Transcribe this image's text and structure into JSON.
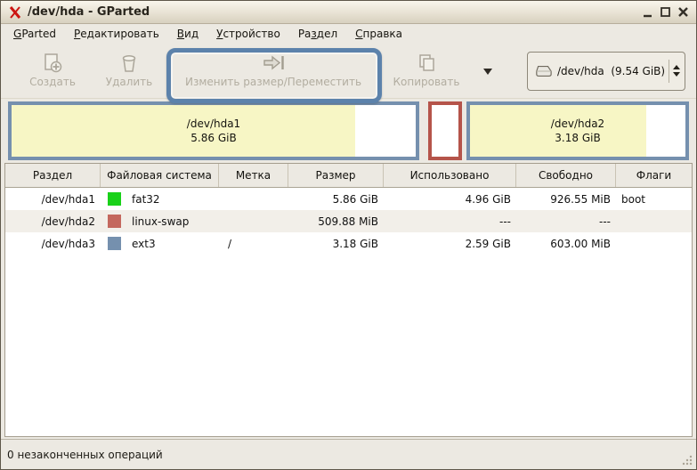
{
  "window": {
    "title": "/dev/hda - GParted"
  },
  "menubar": {
    "items": [
      {
        "pre": "",
        "accel": "G",
        "post": "Parted"
      },
      {
        "pre": "",
        "accel": "Р",
        "post": "едактировать"
      },
      {
        "pre": "",
        "accel": "В",
        "post": "ид"
      },
      {
        "pre": "",
        "accel": "У",
        "post": "стройство"
      },
      {
        "pre": "Ра",
        "accel": "з",
        "post": "дел"
      },
      {
        "pre": "",
        "accel": "С",
        "post": "правка"
      }
    ]
  },
  "toolbar": {
    "new_label": "Создать",
    "delete_label": "Удалить",
    "resize_label": "Изменить размер/Переместить",
    "copy_label": "Копировать",
    "highlight_color": "#5c82ab",
    "device": {
      "value": "/dev/hda  (9.54 GiB)"
    }
  },
  "viz": {
    "blocks": [
      {
        "name": "/dev/hda1",
        "size": "5.86 GiB",
        "border": "#7590ae",
        "fill": "#f7f6c5",
        "used_pct": "85%"
      },
      {
        "name": "",
        "size": "",
        "border": "#b5544a",
        "fill": "#ffffff",
        "used_pct": "0%"
      },
      {
        "name": "/dev/hda2",
        "size": "3.18 GiB",
        "border": "#7590ae",
        "fill": "#f7f6c5",
        "used_pct": "82%"
      }
    ]
  },
  "table": {
    "headers": [
      "Раздел",
      "Файловая система",
      "Метка",
      "Размер",
      "Использовано",
      "Свободно",
      "Флаги"
    ],
    "rows": [
      {
        "partition": "/dev/hda1",
        "fs": "fat32",
        "fs_color": "#19d119",
        "label": "",
        "size": "5.86 GiB",
        "used": "4.96 GiB",
        "free": "926.55 MiB",
        "flags": "boot"
      },
      {
        "partition": "/dev/hda2",
        "fs": "linux-swap",
        "fs_color": "#c4685e",
        "label": "",
        "size": "509.88 MiB",
        "used": "---",
        "free": "---",
        "flags": ""
      },
      {
        "partition": "/dev/hda3",
        "fs": "ext3",
        "fs_color": "#7590ae",
        "label": "/",
        "size": "3.18 GiB",
        "used": "2.59 GiB",
        "free": "603.00 MiB",
        "flags": ""
      }
    ]
  },
  "statusbar": {
    "text": "0 незаконченных операций"
  }
}
